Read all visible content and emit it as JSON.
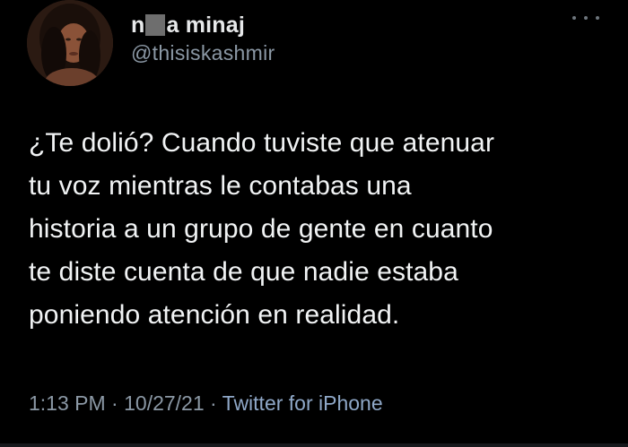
{
  "user": {
    "name_start": "n",
    "name_end": "a minaj",
    "handle": "@thisiskashmir"
  },
  "tweet": {
    "lines": [
      "¿Te dolió? Cuando tuviste que atenuar",
      "tu voz mientras le contabas una",
      "historia a un grupo de gente en cuanto",
      "te diste cuenta de que nadie estaba",
      "poniendo atención en realidad."
    ]
  },
  "meta": {
    "time": "1:13 PM",
    "separator1": " · ",
    "date": "10/27/21",
    "separator2": " · ",
    "source": "Twitter for iPhone"
  },
  "colors": {
    "background": "#000000",
    "text": "#e7e9ea",
    "secondary": "#8b98a5",
    "link": "#8fa8c8"
  },
  "icons": {
    "more": "more-horizontal-icon",
    "avatar": "user-avatar"
  }
}
